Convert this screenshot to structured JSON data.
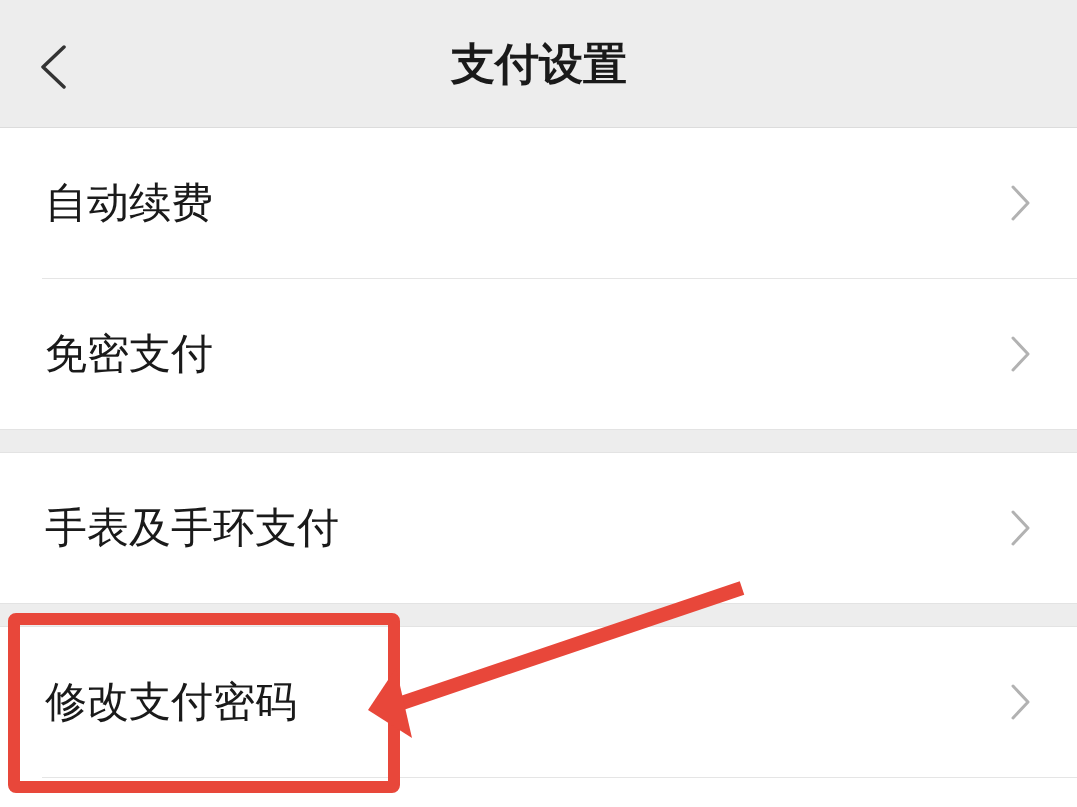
{
  "header": {
    "title": "支付设置"
  },
  "groups": [
    {
      "items": [
        {
          "label": "自动续费",
          "highlighted": false
        },
        {
          "label": "免密支付",
          "highlighted": false
        }
      ]
    },
    {
      "items": [
        {
          "label": "手表及手环支付",
          "highlighted": false
        }
      ]
    },
    {
      "items": [
        {
          "label": "修改支付密码",
          "highlighted": true
        }
      ]
    }
  ]
}
